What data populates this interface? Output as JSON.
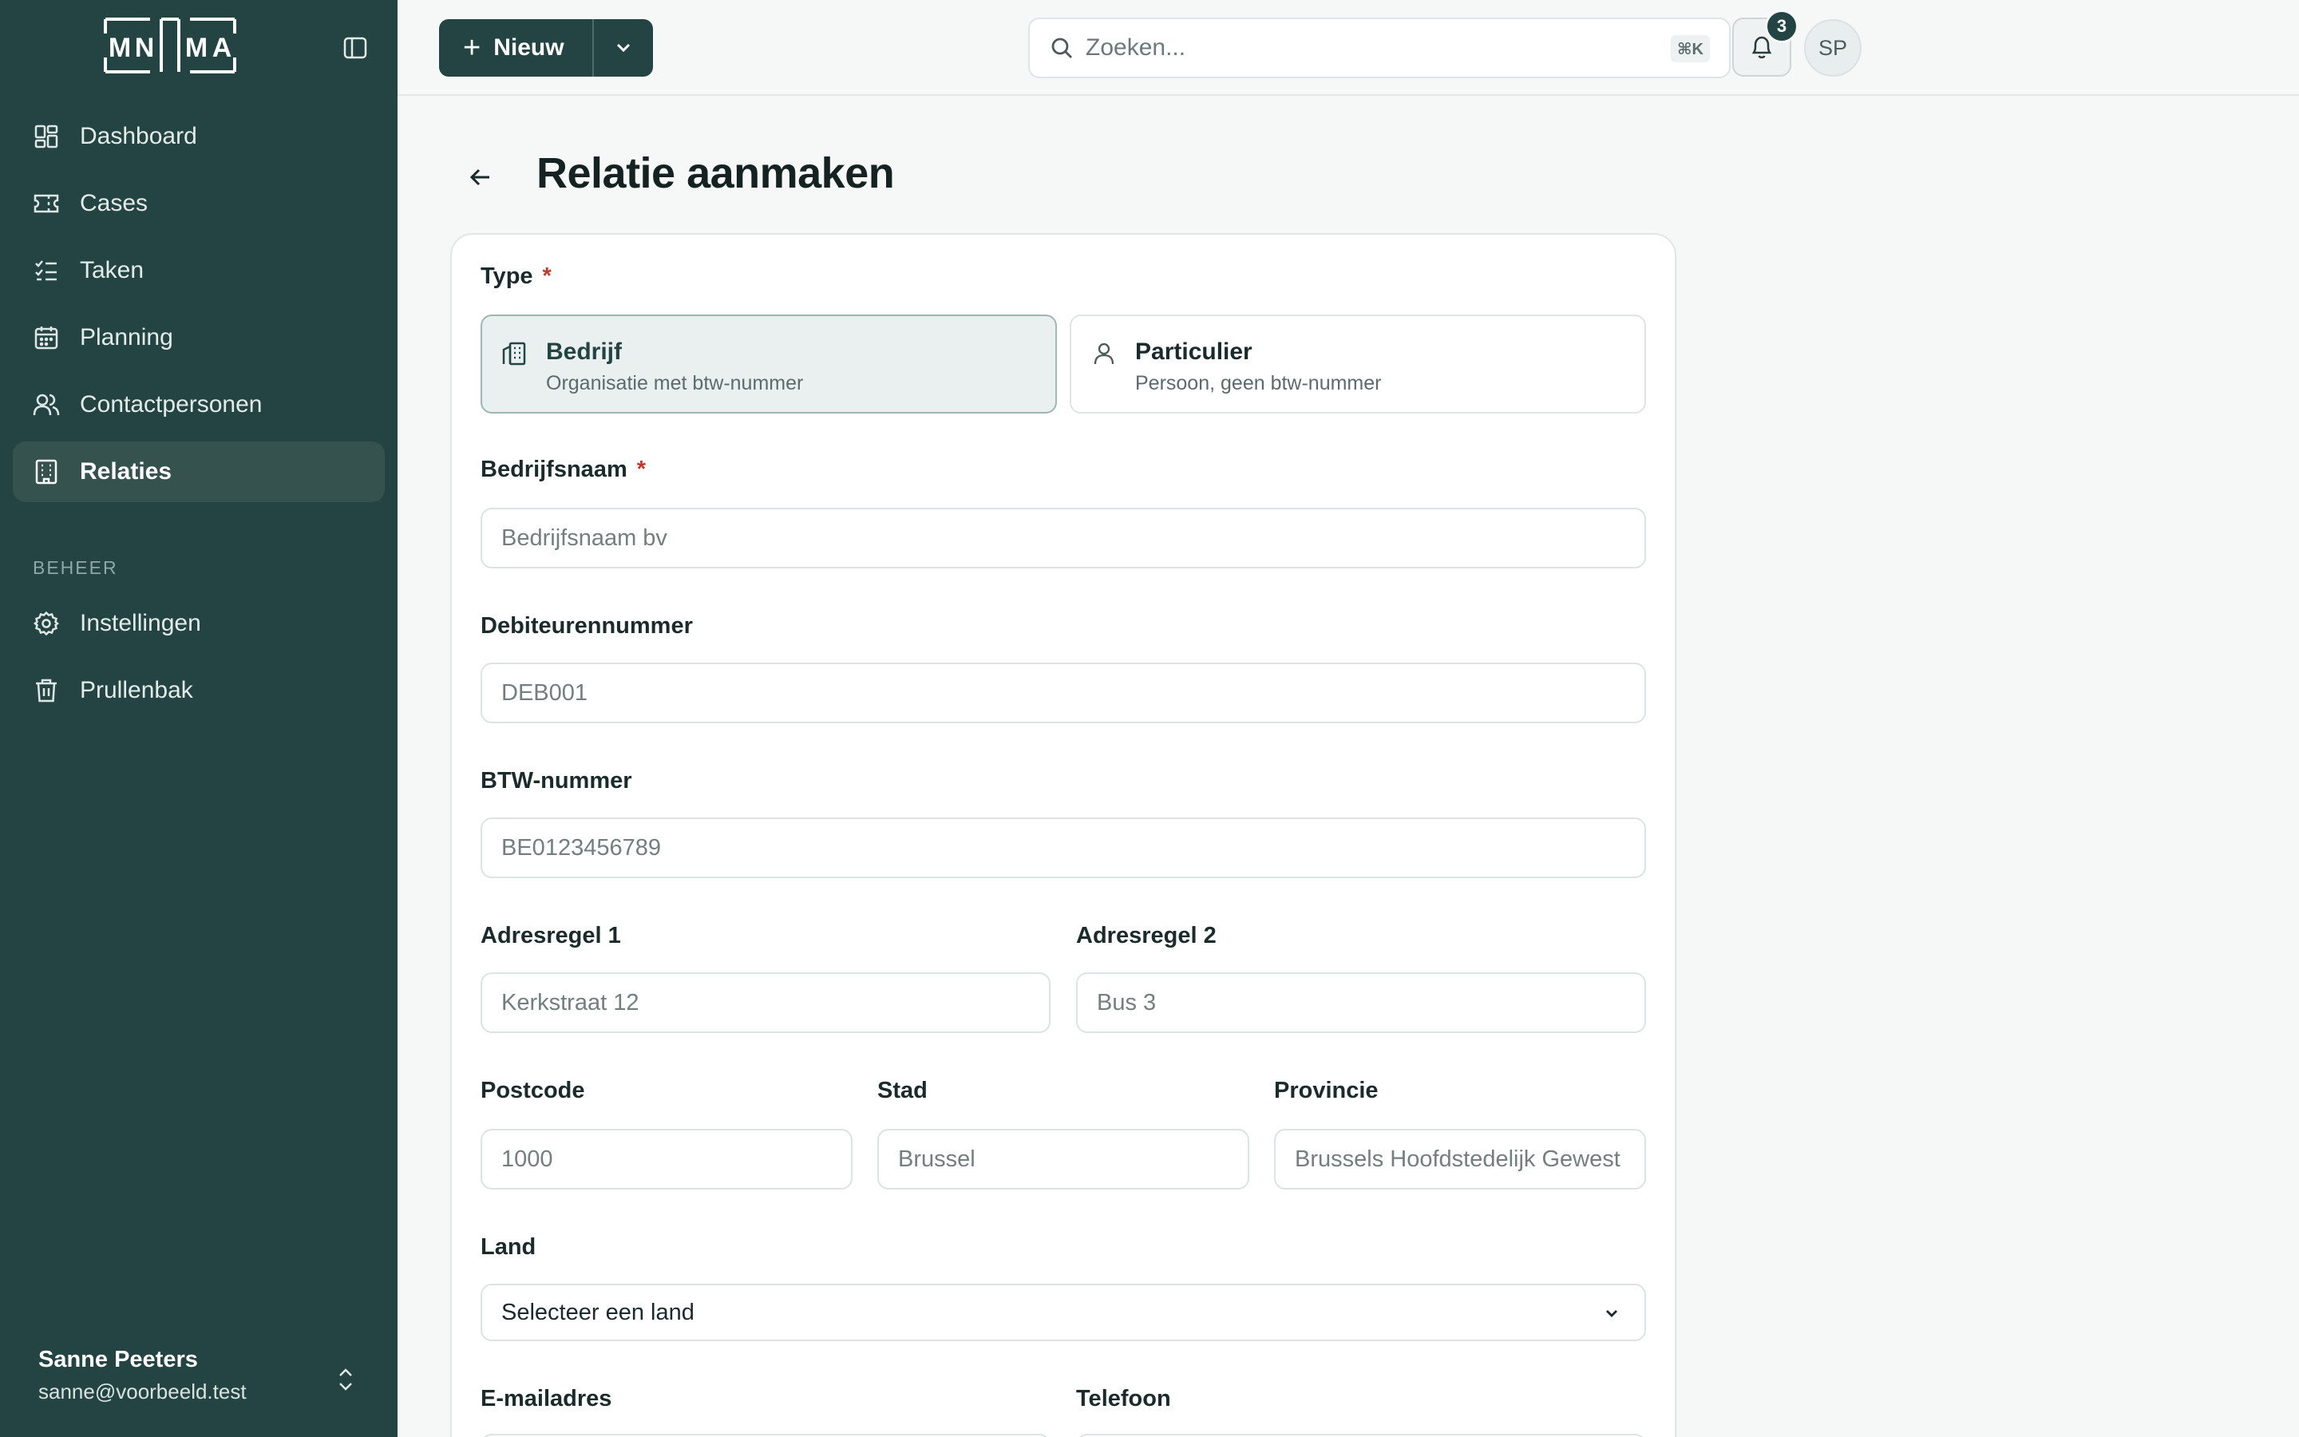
{
  "brand": {
    "logo_text": "MNMA"
  },
  "sidebar": {
    "items": [
      {
        "label": "Dashboard",
        "icon": "dashboard-icon"
      },
      {
        "label": "Cases",
        "icon": "ticket-icon"
      },
      {
        "label": "Taken",
        "icon": "task-list-icon"
      },
      {
        "label": "Planning",
        "icon": "calendar-icon"
      },
      {
        "label": "Contactpersonen",
        "icon": "users-icon"
      },
      {
        "label": "Relaties",
        "icon": "building-icon",
        "active": true
      }
    ],
    "section_label": "BEHEER",
    "items2": [
      {
        "label": "Instellingen",
        "icon": "gear-icon"
      },
      {
        "label": "Prullenbak",
        "icon": "trash-icon"
      }
    ],
    "user": {
      "name": "Sanne Peeters",
      "email": "sanne@voorbeeld.test"
    }
  },
  "topbar": {
    "new_label": "Nieuw",
    "search_placeholder": "Zoeken...",
    "search_shortcut": "⌘K",
    "notification_count": "3",
    "avatar_initials": "SP"
  },
  "page": {
    "title": "Relatie aanmaken"
  },
  "form": {
    "type": {
      "label": "Type",
      "required_mark": "*",
      "options": [
        {
          "title": "Bedrijf",
          "subtitle": "Organisatie met btw-nummer",
          "selected": true
        },
        {
          "title": "Particulier",
          "subtitle": "Persoon, geen btw-nummer",
          "selected": false
        }
      ]
    },
    "company_name": {
      "label": "Bedrijfsnaam",
      "required_mark": "*",
      "placeholder": "Bedrijfsnaam bv",
      "value": ""
    },
    "debtor_number": {
      "label": "Debiteurennummer",
      "placeholder": "DEB001",
      "value": ""
    },
    "vat_number": {
      "label": "BTW-nummer",
      "placeholder": "BE0123456789",
      "value": ""
    },
    "address1": {
      "label": "Adresregel 1",
      "placeholder": "Kerkstraat 12",
      "value": ""
    },
    "address2": {
      "label": "Adresregel 2",
      "placeholder": "Bus 3",
      "value": ""
    },
    "postcode": {
      "label": "Postcode",
      "placeholder": "1000",
      "value": ""
    },
    "city": {
      "label": "Stad",
      "placeholder": "Brussel",
      "value": ""
    },
    "province": {
      "label": "Provincie",
      "placeholder": "Brussels Hoofdstedelijk Gewest",
      "value": ""
    },
    "country": {
      "label": "Land",
      "selected": "Selecteer een land"
    },
    "email": {
      "label": "E-mailadres"
    },
    "phone": {
      "label": "Telefoon"
    }
  },
  "colors": {
    "sidebar_bg": "#234442",
    "accent": "#234442",
    "required": "#c0392b"
  }
}
